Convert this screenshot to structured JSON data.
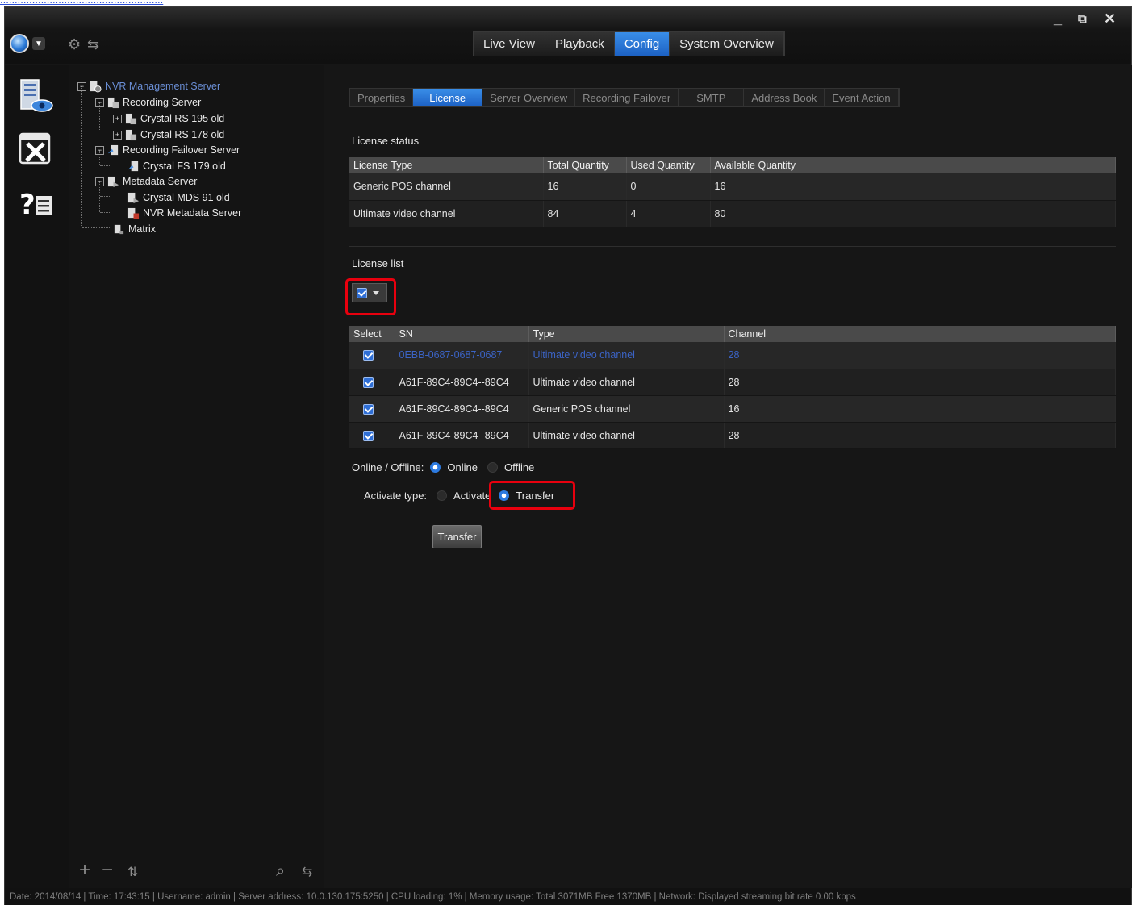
{
  "top_link": {
    "text": "........................................................"
  },
  "window": {
    "controls": {
      "minimize": "_",
      "restore": "⧉",
      "close": "✕"
    }
  },
  "main_tabs": [
    {
      "label": "Live View",
      "active": false
    },
    {
      "label": "Playback",
      "active": false
    },
    {
      "label": "Config",
      "active": true
    },
    {
      "label": "System Overview",
      "active": false
    }
  ],
  "tree": {
    "root": "NVR Management Server",
    "recording_server": "Recording Server",
    "rs1": "Crystal RS 195 old",
    "rs2": "Crystal RS 178 old",
    "failover_server": "Recording Failover Server",
    "fs1": "Crystal FS 179 old",
    "metadata_server": "Metadata Server",
    "mds1": "Crystal MDS 91 old",
    "mds2": "NVR Metadata Server",
    "matrix": "Matrix"
  },
  "sub_tabs": [
    {
      "label": "Properties",
      "active": false
    },
    {
      "label": "License",
      "active": true
    },
    {
      "label": "Server Overview",
      "active": false
    },
    {
      "label": "Recording Failover",
      "active": false
    },
    {
      "label": "SMTP",
      "active": false
    },
    {
      "label": "Address Book",
      "active": false
    },
    {
      "label": "Event Action",
      "active": false
    }
  ],
  "license_status": {
    "title": "License status",
    "columns": [
      "License Type",
      "Total Quantity",
      "Used Quantity",
      "Available Quantity"
    ],
    "rows": [
      [
        "Generic POS channel",
        "16",
        "0",
        "16"
      ],
      [
        "Ultimate video channel",
        "84",
        "4",
        "80"
      ]
    ]
  },
  "license_list": {
    "title": "License list",
    "columns": [
      "Select",
      "SN",
      "Type",
      "Channel"
    ],
    "rows": [
      {
        "sn": "0EBB-0687-0687-0687",
        "type": "Ultimate video channel",
        "channel": "28",
        "checked": true
      },
      {
        "sn": "A61F-89C4-89C4--89C4",
        "type": "Ultimate video channel",
        "channel": "28",
        "checked": true
      },
      {
        "sn": "A61F-89C4-89C4--89C4",
        "type": "Generic POS channel",
        "channel": "16",
        "checked": true
      },
      {
        "sn": "A61F-89C4-89C4--89C4",
        "type": "Ultimate video channel",
        "channel": "28",
        "checked": true
      }
    ]
  },
  "online_offline": {
    "label": "Online / Offline:",
    "online": "Online",
    "offline": "Offline",
    "selected": "Online"
  },
  "activate_type": {
    "label": "Activate type:",
    "activate": "Activate",
    "transfer": "Transfer",
    "selected": "Transfer"
  },
  "transfer_button": "Transfer",
  "status_bar": "Date: 2014/08/14  |  Time: 17:43:15  |  Username: admin  |  Server address: 10.0.130.175:5250  |  CPU loading: 1%  |  Memory usage: Total 3071MB  Free 1370MB  |  Network: Displayed streaming bit rate    0.00 kbps",
  "colors": {
    "accent": "#2c7ae0",
    "highlight_box": "#e8000e",
    "selected_row_text": "#3b63c5"
  }
}
